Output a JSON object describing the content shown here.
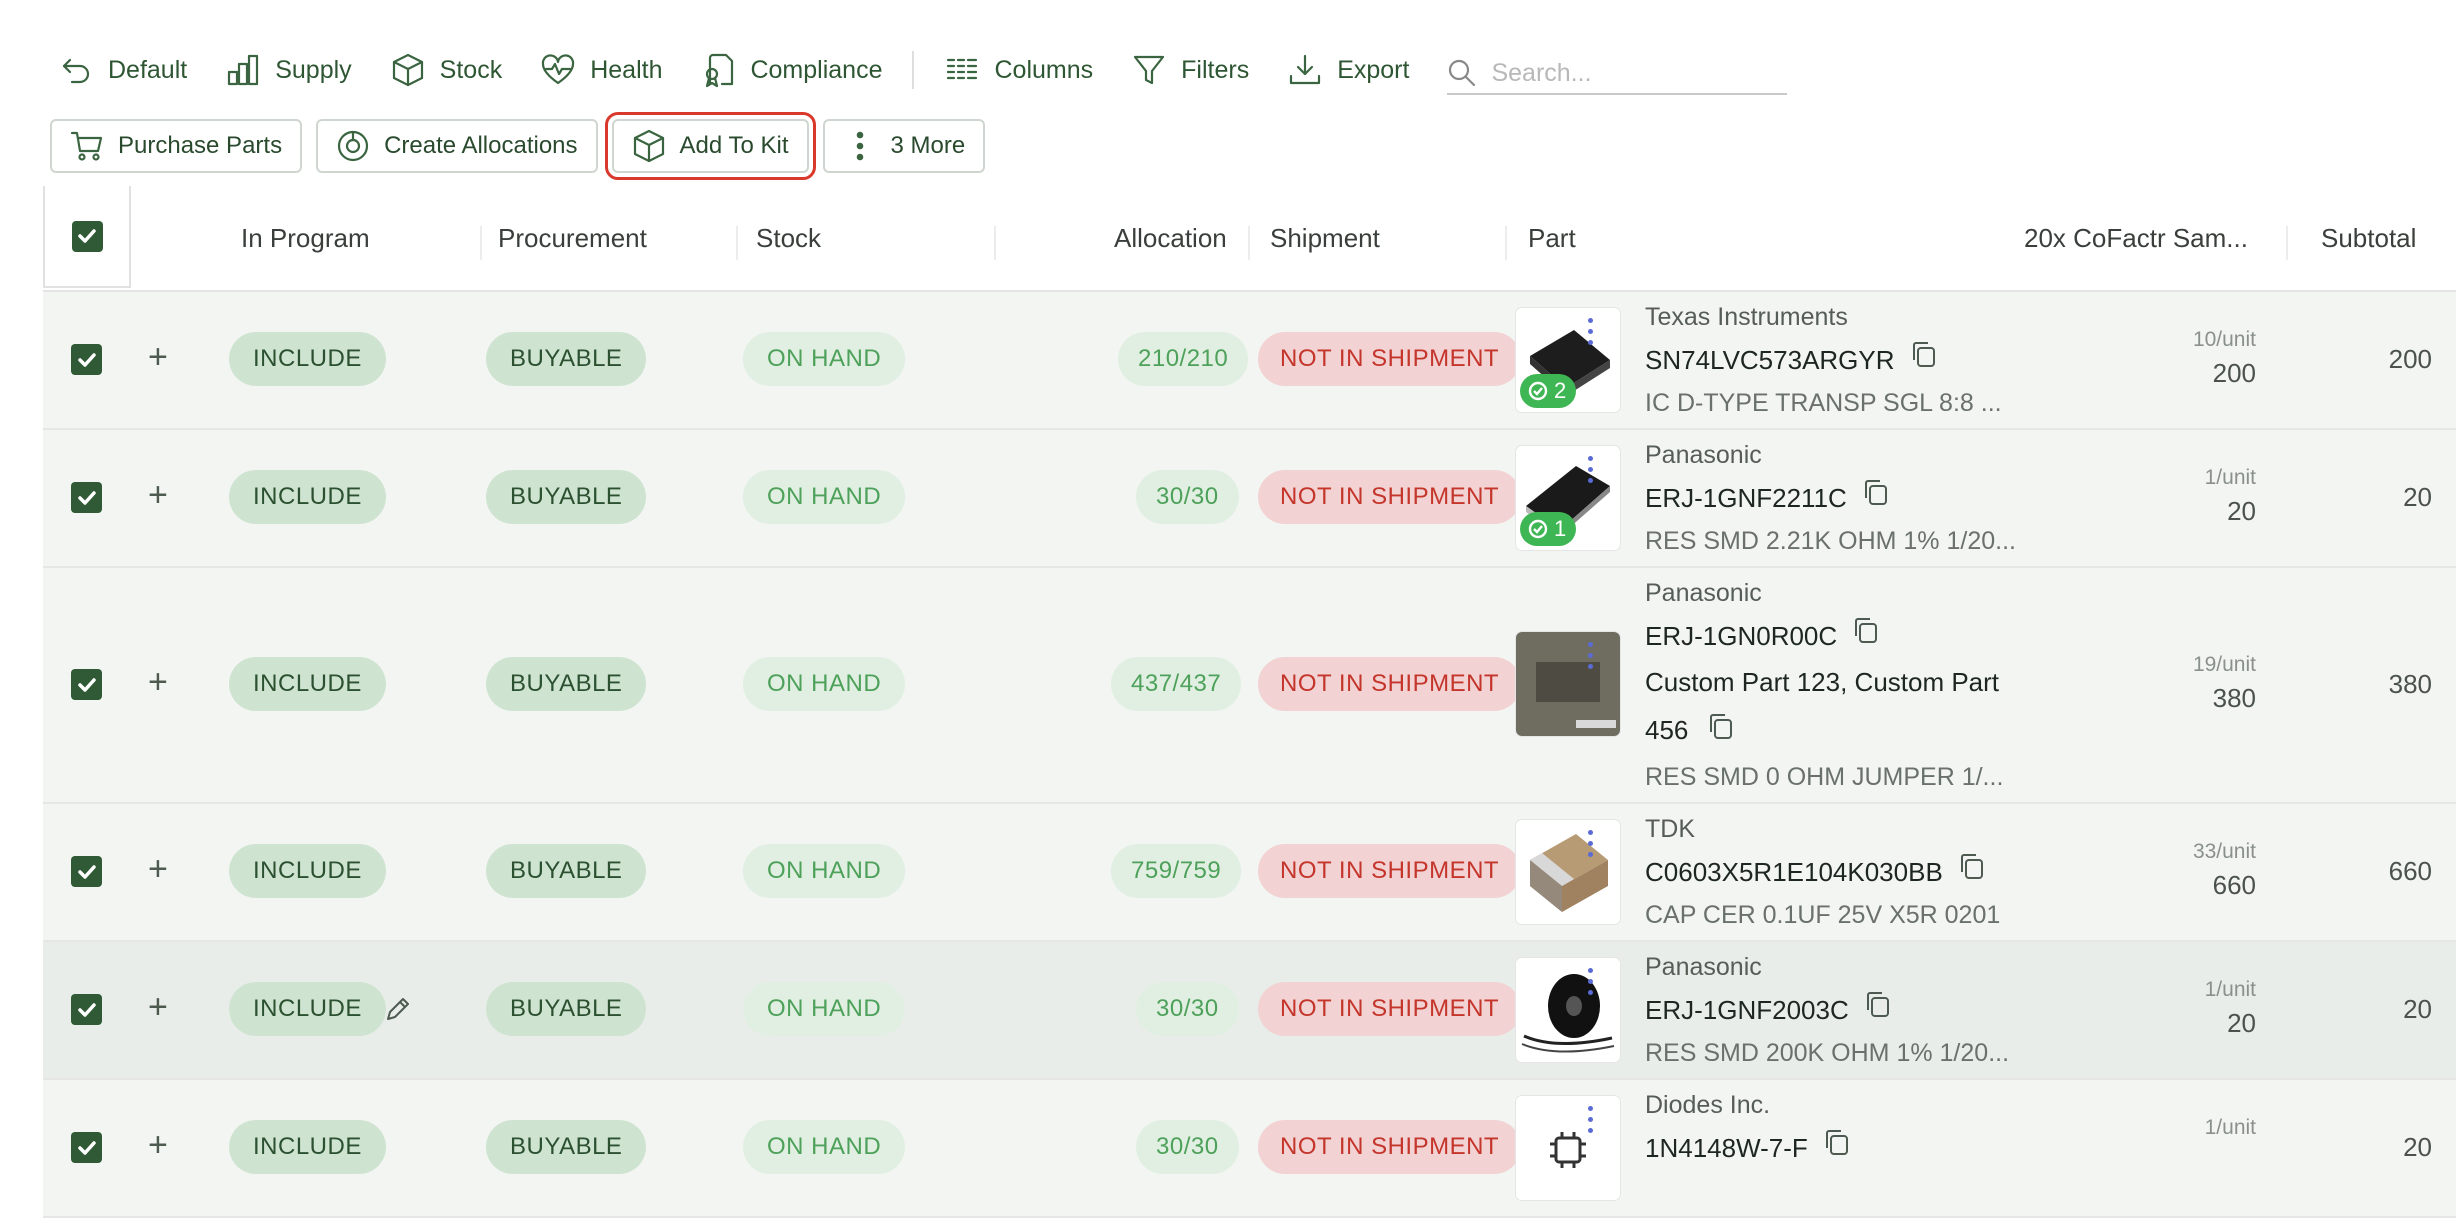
{
  "toolbar": {
    "items": [
      {
        "label": "Default",
        "icon": "undo-arrow-icon"
      },
      {
        "label": "Supply",
        "icon": "bar-chart-icon"
      },
      {
        "label": "Stock",
        "icon": "box-icon"
      },
      {
        "label": "Health",
        "icon": "heartbeat-icon"
      },
      {
        "label": "Compliance",
        "icon": "certificate-icon"
      },
      {
        "label": "Columns",
        "icon": "columns-icon"
      },
      {
        "label": "Filters",
        "icon": "filter-icon"
      },
      {
        "label": "Export",
        "icon": "download-icon"
      }
    ],
    "search_placeholder": "Search..."
  },
  "actions": {
    "purchase": "Purchase Parts",
    "allocations": "Create Allocations",
    "add_to_kit": "Add To Kit",
    "more": "3 More"
  },
  "table": {
    "headers": {
      "in_program": "In Program",
      "procurement": "Procurement",
      "stock": "Stock",
      "allocation": "Allocation",
      "shipment": "Shipment",
      "part": "Part",
      "build": "20x CoFactr Sam...",
      "subtotal": "Subtotal"
    },
    "rows": [
      {
        "include": "INCLUDE",
        "procurement": "BUYABLE",
        "stock": "ON HAND",
        "allocation": "210/210",
        "shipment": "NOT IN SHIPMENT",
        "badge": "2",
        "manufacturer": "Texas Instruments",
        "mpn": "SN74LVC573ARGYR",
        "custom": "",
        "custom_tail": "",
        "description": "IC D-TYPE TRANSP SGL 8:8 ...",
        "per_unit": "10/unit",
        "qty": "200",
        "subtotal": "200"
      },
      {
        "include": "INCLUDE",
        "procurement": "BUYABLE",
        "stock": "ON HAND",
        "allocation": "30/30",
        "shipment": "NOT IN SHIPMENT",
        "badge": "1",
        "manufacturer": "Panasonic",
        "mpn": "ERJ-1GNF2211C",
        "custom": "",
        "custom_tail": "",
        "description": "RES SMD 2.21K OHM 1% 1/20...",
        "per_unit": "1/unit",
        "qty": "20",
        "subtotal": "20"
      },
      {
        "include": "INCLUDE",
        "procurement": "BUYABLE",
        "stock": "ON HAND",
        "allocation": "437/437",
        "shipment": "NOT IN SHIPMENT",
        "badge": "",
        "manufacturer": "Panasonic",
        "mpn": "ERJ-1GN0R00C",
        "custom": "Custom Part 123, Custom Part",
        "custom_tail": "456",
        "description": "RES SMD 0 OHM JUMPER 1/...",
        "per_unit": "19/unit",
        "qty": "380",
        "subtotal": "380"
      },
      {
        "include": "INCLUDE",
        "procurement": "BUYABLE",
        "stock": "ON HAND",
        "allocation": "759/759",
        "shipment": "NOT IN SHIPMENT",
        "badge": "",
        "manufacturer": "TDK",
        "mpn": "C0603X5R1E104K030BB",
        "custom": "",
        "custom_tail": "",
        "description": "CAP CER 0.1UF 25V X5R 0201",
        "per_unit": "33/unit",
        "qty": "660",
        "subtotal": "660"
      },
      {
        "include": "INCLUDE",
        "procurement": "BUYABLE",
        "stock": "ON HAND",
        "allocation": "30/30",
        "shipment": "NOT IN SHIPMENT",
        "badge": "",
        "manufacturer": "Panasonic",
        "mpn": "ERJ-1GNF2003C",
        "custom": "",
        "custom_tail": "",
        "description": "RES SMD 200K OHM 1% 1/20...",
        "per_unit": "1/unit",
        "qty": "20",
        "subtotal": "20"
      },
      {
        "include": "INCLUDE",
        "procurement": "BUYABLE",
        "stock": "ON HAND",
        "allocation": "30/30",
        "shipment": "NOT IN SHIPMENT",
        "badge": "",
        "manufacturer": "Diodes Inc.",
        "mpn": "1N4148W-7-F",
        "custom": "",
        "custom_tail": "",
        "description": "",
        "per_unit": "1/unit",
        "qty": "",
        "subtotal": "20"
      }
    ]
  },
  "colors": {
    "accent": "#2f5a35",
    "include_bg": "#cfe3d1",
    "onhand_text": "#4ea15a",
    "shipment_bg": "#f2d2d2",
    "shipment_text": "#c4352b",
    "highlight": "#d9392b"
  }
}
